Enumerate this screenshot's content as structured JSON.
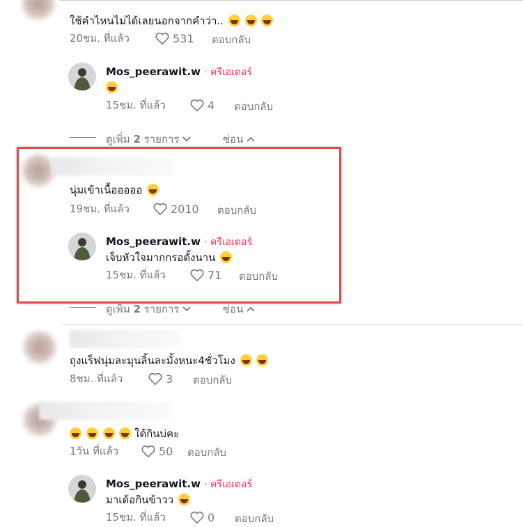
{
  "colors": {
    "creator": "#fe2c55",
    "meta": "#7a7a7a",
    "highlight": "#e04b4b"
  },
  "comment1": {
    "text": "ใช้คำไหนไม่ได้เลยนอกจากคำว่า..",
    "time": "20ชม. ที่แล้ว",
    "likes": "531",
    "reply": "ตอบกลับ"
  },
  "reply1": {
    "name": "Mos_peerawit.w",
    "badge": "· ครีเอเตอร์",
    "text": "",
    "time": "15ชม. ที่แล้ว",
    "likes": "4",
    "reply": "ตอบกลับ"
  },
  "expand1": {
    "more_prefix": "ดูเพิ่ม",
    "more_count": "2",
    "more_suffix": "รายการ",
    "hide": "ซ่อน"
  },
  "comment2": {
    "text": "นุ่มเข้าเนื้อออออ",
    "time": "19ชม. ที่แล้ว",
    "likes": "2010",
    "reply": "ตอบกลับ"
  },
  "reply2": {
    "name": "Mos_peerawit.w",
    "badge": "· ครีเอเตอร์",
    "text": "เจ็บหัวใจมากกรอตั้งนาน",
    "time": "15ชม. ที่แล้ว",
    "likes": "71",
    "reply": "ตอบกลับ"
  },
  "expand2": {
    "more_prefix": "ดูเพิ่ม",
    "more_count": "2",
    "more_suffix": "รายการ",
    "hide": "ซ่อน"
  },
  "comment3": {
    "text": "ถุงแร็ฟนุ่มละมุนลิ้นละมั้งหนะ4ชั่วโมง",
    "time": "8ชม. ที่แล้ว",
    "likes": "3",
    "reply": "ตอบกลับ"
  },
  "comment4": {
    "text": "ใด้กินบ่คะ",
    "time": "1วัน ที่แล้ว",
    "likes": "50",
    "reply": "ตอบกลับ"
  },
  "reply3": {
    "name": "Mos_peerawit.w",
    "badge": "· ครีเอเตอร์",
    "text": "มาเด้อกินข้าวว",
    "time": "15ชม. ที่แล้ว",
    "likes": "0",
    "reply": "ตอบกลับ"
  },
  "icons": {
    "heart": "heart-outline-icon",
    "chevron_down": "chevron-down-icon",
    "chevron_up": "chevron-up-icon",
    "emoji_laugh": "rofl-emoji-icon",
    "emoji_joy": "grin-emoji-icon"
  }
}
